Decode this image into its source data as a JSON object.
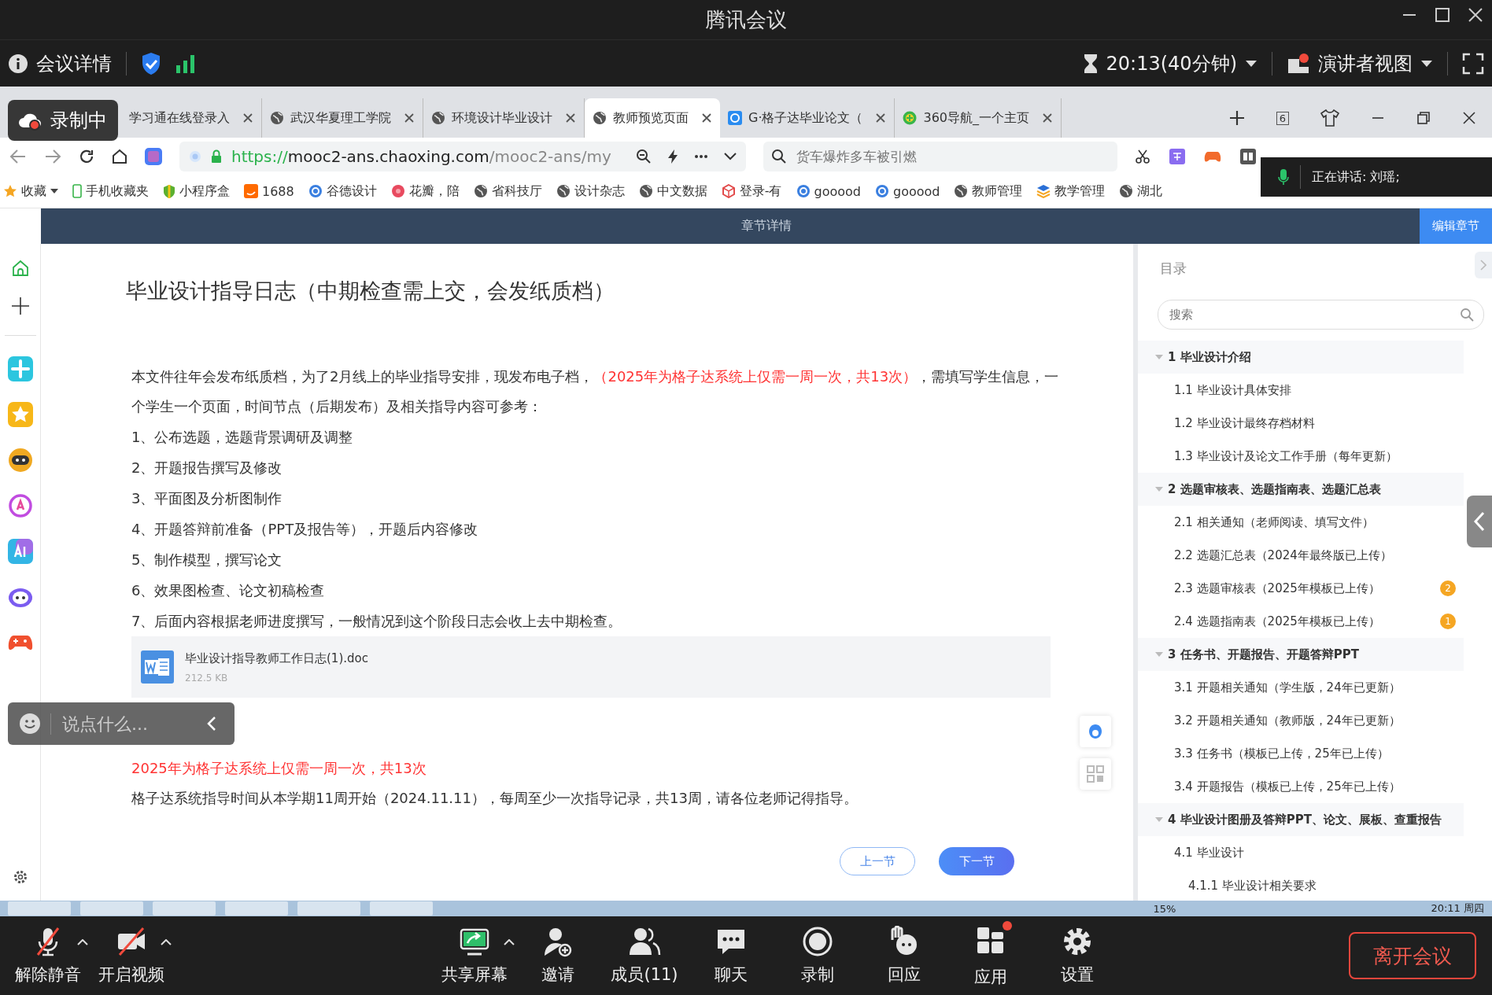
{
  "window": {
    "title": "腾讯会议"
  },
  "meeting_bar": {
    "details": "会议详情",
    "timer": "20:13(40分钟)",
    "view": "演讲者视图"
  },
  "recording_badge": {
    "label": "录制中"
  },
  "speaking_indicator": {
    "label": "正在讲话:",
    "speaker": "刘瑶;"
  },
  "browser": {
    "tabs": [
      {
        "title": "学习通在线登录入",
        "selected": false
      },
      {
        "title": "武汉华夏理工学院",
        "selected": false
      },
      {
        "title": "环境设计毕业设计",
        "selected": false
      },
      {
        "title": "教师预览页面",
        "selected": true
      },
      {
        "title": "G·格子达毕业论文（",
        "selected": false
      },
      {
        "title": "360导航_一个主页",
        "selected": false
      }
    ],
    "tab_count": "6",
    "address": {
      "scheme": "https://",
      "host": "mooc2-ans.chaoxing.com",
      "path": "/mooc2-ans/my"
    },
    "search": {
      "placeholder": "货车爆炸多车被引燃"
    },
    "bookmarks": [
      {
        "label": "收藏"
      },
      {
        "label": "手机收藏夹"
      },
      {
        "label": "小程序盒"
      },
      {
        "label": "1688"
      },
      {
        "label": "谷德设计"
      },
      {
        "label": "花瓣，陪"
      },
      {
        "label": "省科技厅"
      },
      {
        "label": "设计杂志"
      },
      {
        "label": "中文数据"
      },
      {
        "label": "登录-有"
      },
      {
        "label": "gooood"
      },
      {
        "label": "gooood"
      },
      {
        "label": "教师管理"
      },
      {
        "label": "教学管理"
      },
      {
        "label": "湖北"
      }
    ]
  },
  "page": {
    "header": "章节详情",
    "edit_button": "编辑章节",
    "title": "毕业设计指导日志（中期检查需上交，会发纸质档）",
    "intro": [
      {
        "text": "本文件往年会发布纸质档，为了2月线上的毕业指导安排，现发布电子档，",
        "emphasis": false
      },
      {
        "text": "（2025年为格子达系统上仅需一周一次，共13次）",
        "emphasis": true
      },
      {
        "text": "，需填写学生信息，一个学生一个页面，时间节点（后期发布）及相关指导内容可参考：",
        "emphasis": false
      }
    ],
    "list": [
      "1、公布选题，选题背景调研及调整",
      "2、开题报告撰写及修改",
      "3、平面图及分析图制作",
      "4、开题答辩前准备（PPT及报告等），开题后内容修改",
      "5、制作模型，撰写论文",
      "6、效果图检查、论文初稿检查",
      "7、后面内容根据老师进度撰写，一般情况到这个阶段日志会收上去中期检查。"
    ],
    "attachment": {
      "name": "毕业设计指导教师工作日志(1).doc",
      "size": "212.5 KB"
    },
    "notice": {
      "headline": "2025年为格子达系统上仅需一周一次，共13次",
      "text": "格子达系统指导时间从本学期11周开始（2024.11.11），每周至少一次指导记录，共13周，请各位老师记得指导。"
    },
    "prev_button": "上一节",
    "next_button": "下一节"
  },
  "toc": {
    "title": "目录",
    "search": {
      "placeholder": "搜索"
    },
    "items": [
      {
        "label": "1 毕业设计介绍",
        "expanded": true,
        "children": [
          {
            "label": "1.1 毕业设计具体安排"
          },
          {
            "label": "1.2 毕业设计最终存档材料"
          },
          {
            "label": "1.3 毕业设计及论文工作手册（每年更新）"
          }
        ]
      },
      {
        "label": "2 选题审核表、选题指南表、选题汇总表",
        "expanded": true,
        "children": [
          {
            "label": "2.1 相关通知（老师阅读、填写文件）"
          },
          {
            "label": "2.2 选题汇总表（2024年最终版已上传）"
          },
          {
            "label": "2.3 选题审核表（2025年模板已上传）",
            "badge": "2"
          },
          {
            "label": "2.4 选题指南表（2025年模板已上传）",
            "badge": "1"
          }
        ]
      },
      {
        "label": "3 任务书、开题报告、开题答辩PPT",
        "expanded": true,
        "children": [
          {
            "label": "3.1 开题相关通知（学生版，24年已更新）"
          },
          {
            "label": "3.2 开题相关通知（教师版，24年已更新）"
          },
          {
            "label": "3.3 任务书（模板已上传，25年已上传）"
          },
          {
            "label": "3.4 开题报告（模板已上传，25年已上传）"
          }
        ]
      },
      {
        "label": "4 毕业设计图册及答辩PPT、论文、展板、查重报告",
        "expanded": true,
        "children": [
          {
            "label": "4.1 毕业设计",
            "children": [
              {
                "label": "4.1.1 毕业设计相关要求"
              }
            ]
          }
        ]
      }
    ]
  },
  "chat": {
    "placeholder": "说点什么..."
  },
  "taskbar": {
    "battery": "15%",
    "clock": "20:11 周四"
  },
  "toolbar": [
    {
      "label": "解除静音",
      "kind": "mic-off",
      "menu": true,
      "alert": false
    },
    {
      "label": "开启视频",
      "kind": "video-off",
      "menu": true,
      "alert": false
    },
    {
      "label": "共享屏幕",
      "kind": "share",
      "menu": true,
      "alert": false
    },
    {
      "label": "邀请",
      "kind": "invite",
      "menu": false,
      "alert": false
    },
    {
      "label": "成员(11)",
      "kind": "members",
      "menu": false,
      "alert": false
    },
    {
      "label": "聊天",
      "kind": "chat",
      "menu": false,
      "alert": false
    },
    {
      "label": "录制",
      "kind": "record",
      "menu": false,
      "alert": false
    },
    {
      "label": "回应",
      "kind": "react",
      "menu": false,
      "alert": false
    },
    {
      "label": "应用",
      "kind": "apps",
      "menu": false,
      "alert": true
    },
    {
      "label": "设置",
      "kind": "settings",
      "menu": false,
      "alert": false
    }
  ],
  "leave_button": "离开会议"
}
